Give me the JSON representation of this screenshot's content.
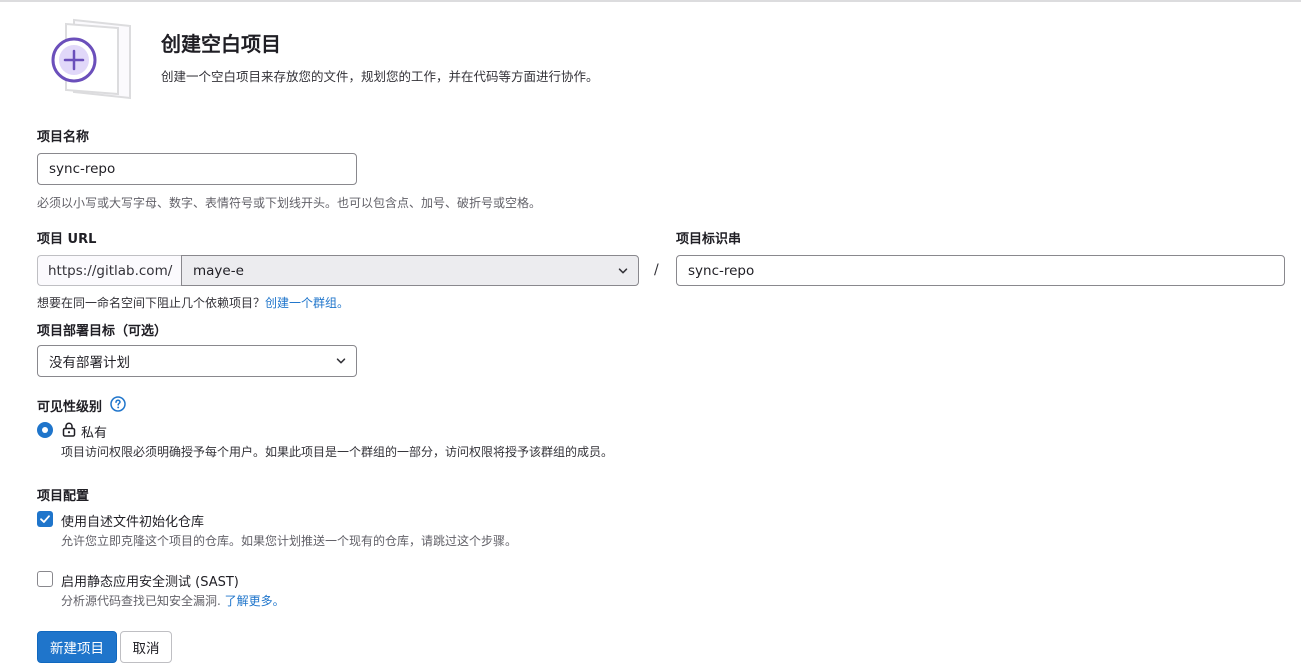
{
  "header": {
    "title": "创建空白项目",
    "description": "创建一个空白项目来存放您的文件，规划您的工作，并在代码等方面进行协作。"
  },
  "project_name": {
    "label": "项目名称",
    "value": "sync-repo",
    "help": "必须以小写或大写字母、数字、表情符号或下划线开头。也可以包含点、加号、破折号或空格。"
  },
  "project_url": {
    "label": "项目 URL",
    "prefix": "https://gitlab.com/",
    "namespace": "maye-e",
    "separator": "/",
    "help_text": "想要在同一命名空间下阻止几个依赖项目？",
    "help_link": "创建一个群组。"
  },
  "project_slug": {
    "label": "项目标识串",
    "value": "sync-repo"
  },
  "deployment": {
    "label": "项目部署目标（可选）",
    "selected": "没有部署计划"
  },
  "visibility": {
    "label": "可见性级别",
    "option_label": "私有",
    "option_desc": "项目访问权限必须明确授予每个用户。如果此项目是一个群组的一部分，访问权限将授予该群组的成员。"
  },
  "config": {
    "label": "项目配置",
    "readme_label": "使用自述文件初始化仓库",
    "readme_desc": "允许您立即克隆这个项目的仓库。如果您计划推送一个现有的仓库，请跳过这个步骤。",
    "sast_label": "启用静态应用安全测试 (SAST)",
    "sast_desc": "分析源代码查找已知安全漏洞.",
    "sast_link": "了解更多。"
  },
  "actions": {
    "create_label": "新建项目",
    "cancel_label": "取消"
  },
  "colors": {
    "primary": "#1f75cb",
    "illustration_purple": "#6b4fbb"
  }
}
